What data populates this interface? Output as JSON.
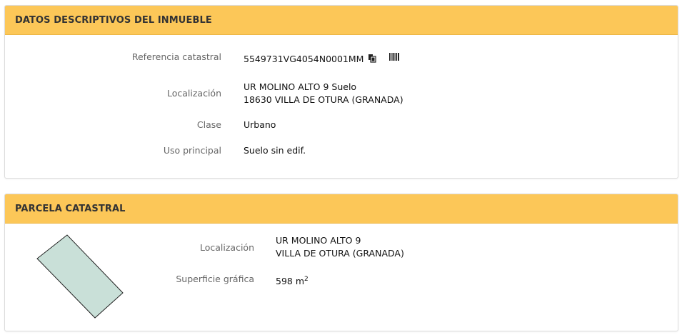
{
  "datos": {
    "title": "DATOS DESCRIPTIVOS DEL INMUEBLE",
    "referencia_label": "Referencia catastral",
    "referencia_value": "5549731VG4054N0001MM",
    "copy_icon": "copy-icon",
    "barcode_icon": "barcode-icon",
    "localizacion_label": "Localización",
    "localizacion_line1": "UR MOLINO ALTO 9 Suelo",
    "localizacion_line2": "18630 VILLA DE OTURA (GRANADA)",
    "clase_label": "Clase",
    "clase_value": "Urbano",
    "uso_label": "Uso principal",
    "uso_value": "Suelo sin edif."
  },
  "parcela": {
    "title": "PARCELA CATASTRAL",
    "localizacion_label": "Localización",
    "localizacion_line1": "UR MOLINO ALTO 9",
    "localizacion_line2": "VILLA DE OTURA (GRANADA)",
    "superficie_label": "Superficie gráfica",
    "superficie_value": "598 m",
    "superficie_unit_sup": "2",
    "parcel_fill": "#c9e0d8"
  },
  "colors": {
    "header_bg": "#fcc758",
    "label": "#666666"
  }
}
